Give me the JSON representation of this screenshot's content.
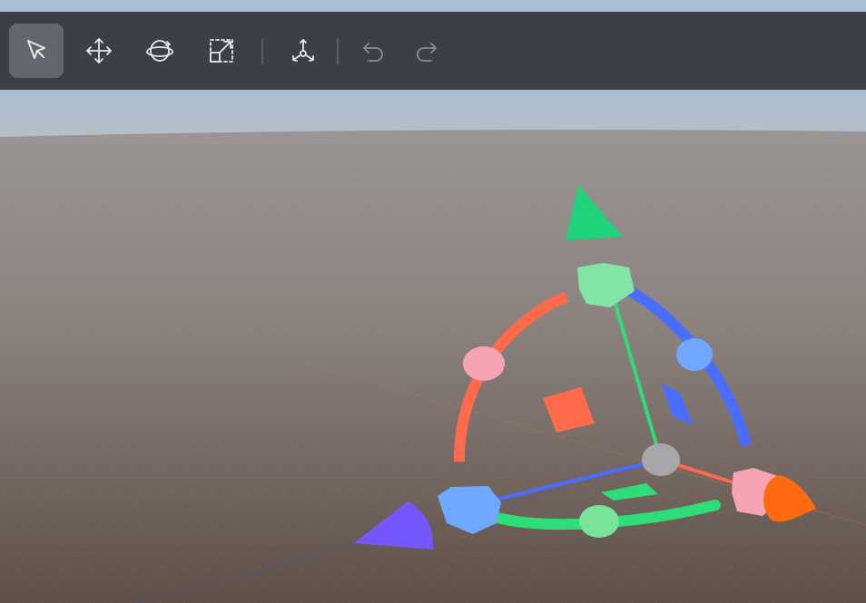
{
  "toolbar": {
    "tools": [
      {
        "name": "select",
        "icon": "cursor-arrow-icon",
        "active": true
      },
      {
        "name": "move",
        "icon": "move-arrows-icon",
        "active": false
      },
      {
        "name": "rotate",
        "icon": "rotate-orbit-icon",
        "active": false
      },
      {
        "name": "scale",
        "icon": "scale-box-icon",
        "active": false
      },
      {
        "name": "transform-gizmo",
        "icon": "axis-gizmo-icon",
        "active": false
      },
      {
        "name": "undo",
        "icon": "undo-icon",
        "enabled": false
      },
      {
        "name": "redo",
        "icon": "redo-icon",
        "enabled": false
      }
    ]
  },
  "colors": {
    "toolbar_bg": "#3d3f46",
    "active_tool_bg": "#63666d",
    "icon": "#e6e7ea",
    "icon_disabled": "#8a8c92",
    "sky": "#a9bdd2",
    "ground": "#8f8a86",
    "axis_x": "#ff6b4a",
    "axis_y": "#2fdc7a",
    "axis_z": "#4a6cff",
    "pivot": "#a8a6a8"
  },
  "viewport": {
    "gizmo": "transform-gizmo"
  }
}
